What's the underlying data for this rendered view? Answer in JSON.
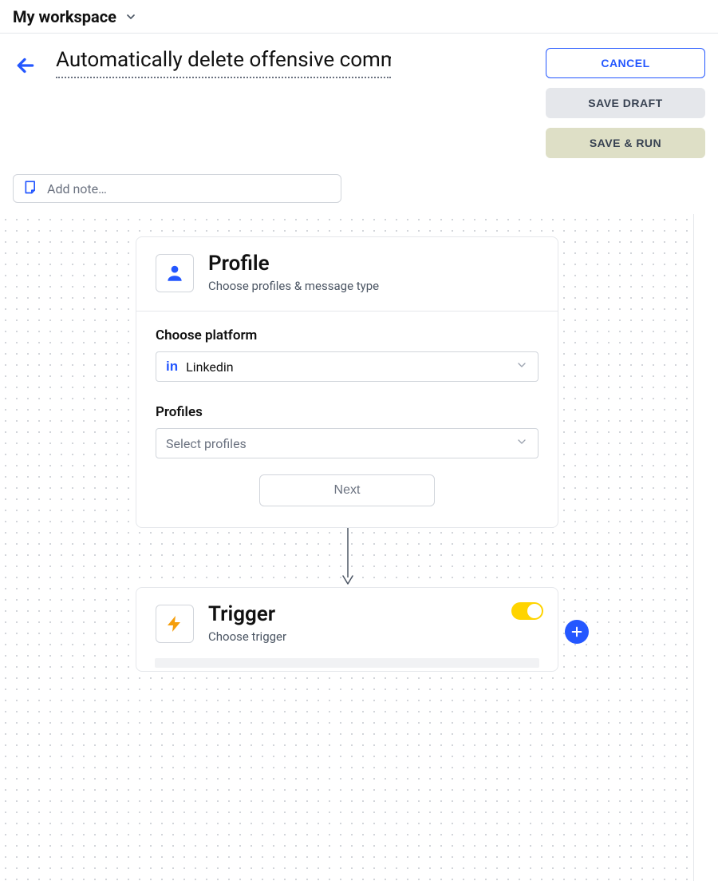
{
  "workspace": {
    "name": "My workspace"
  },
  "header": {
    "title": "Automatically delete offensive comments",
    "actions": {
      "cancel": "Cancel",
      "save_draft": "Save Draft",
      "save_run": "Save & Run"
    }
  },
  "note": {
    "placeholder": "Add note…"
  },
  "profile_card": {
    "title": "Profile",
    "subtitle": "Choose profiles & message type",
    "platform_label": "Choose platform",
    "platform_selected": "Linkedin",
    "profiles_label": "Profiles",
    "profiles_placeholder": "Select profiles",
    "next_label": "Next"
  },
  "trigger_card": {
    "title": "Trigger",
    "subtitle": "Choose trigger",
    "enabled": true
  }
}
